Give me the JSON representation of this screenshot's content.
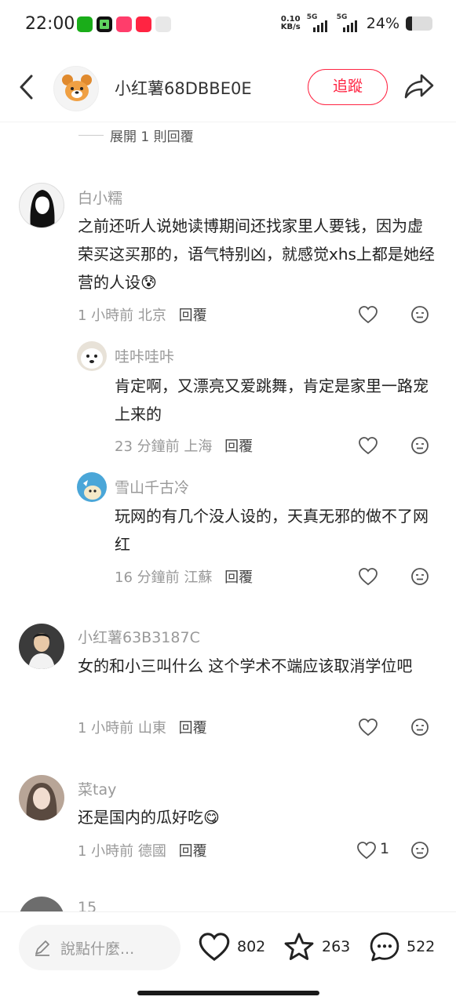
{
  "status_bar": {
    "time": "22:00",
    "net_speed_value": "0.10",
    "net_speed_unit": "KB/s",
    "signal_1": "5G",
    "signal_2": "5G",
    "battery": "24%"
  },
  "header": {
    "title": "小红薯68DBBE0E",
    "follow_label": "追蹤"
  },
  "expand_replies": "展開 1 則回覆",
  "comments": [
    {
      "name": "白小糯",
      "text": "之前还听人说她读博期间还找家里人要钱，因为虚荣买这买那的，语气特别凶，就感觉xhs上都是她经营的人设😰",
      "time": "1 小時前",
      "location": "北京",
      "reply": "回覆",
      "replies": [
        {
          "name": "哇咔哇咔",
          "text": "肯定啊，又漂亮又爱跳舞，肯定是家里一路宠上来的",
          "time": "23 分鐘前",
          "location": "上海",
          "reply": "回覆"
        },
        {
          "name": "雪山千古冷",
          "text": "玩网的有几个没人设的，天真无邪的做不了网红",
          "time": "16 分鐘前",
          "location": "江蘇",
          "reply": "回覆"
        }
      ]
    },
    {
      "name": "小红薯63B3187C",
      "text": "女的和小三叫什么 这个学术不端应该取消学位吧",
      "time": "1 小時前",
      "location": "山東",
      "reply": "回覆"
    },
    {
      "name": "菜tay",
      "text": "还是国内的瓜好吃😋",
      "time": "1 小時前",
      "location": "德國",
      "reply": "回覆",
      "likes": "1"
    },
    {
      "name": "15"
    }
  ],
  "bottom_bar": {
    "placeholder": "說點什麼...",
    "likes": "802",
    "collects": "263",
    "comments": "522"
  },
  "colors": {
    "accent": "#ff2442",
    "meta": "#999999",
    "text": "#222222"
  }
}
